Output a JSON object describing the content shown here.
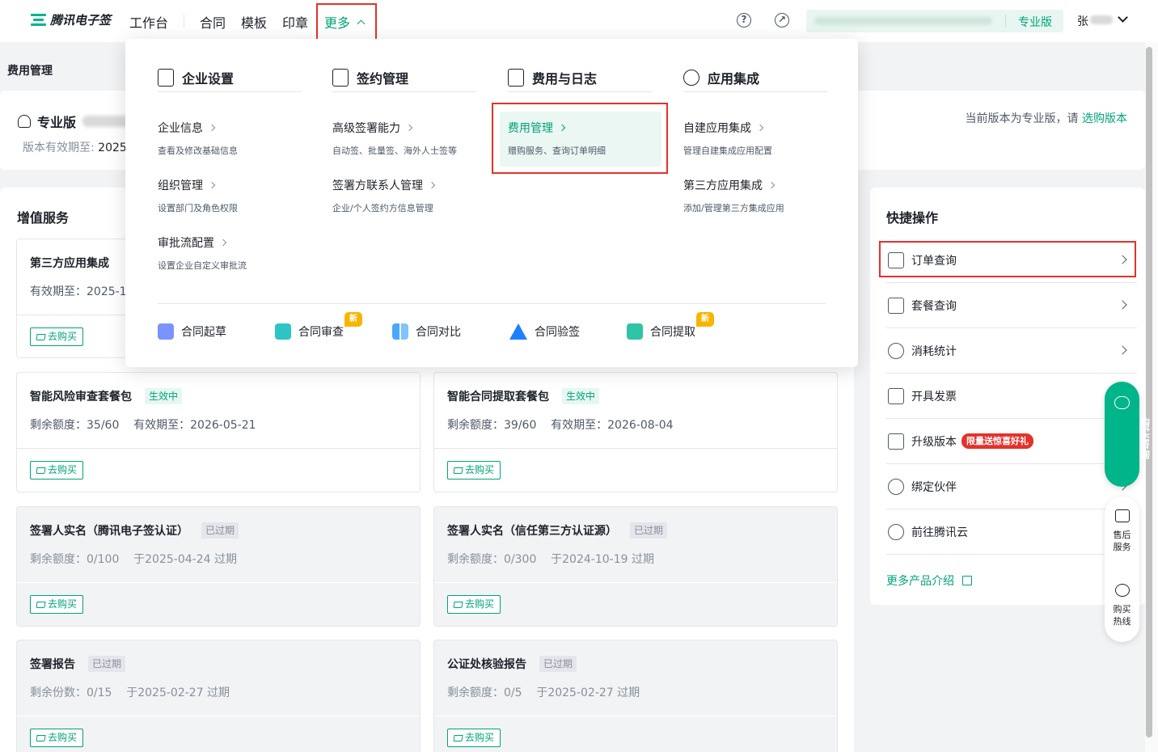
{
  "header": {
    "brand": "腾讯电子签",
    "nav": [
      "工作台",
      "合同",
      "模板",
      "印章"
    ],
    "more_label": "更多",
    "help_icon": "question-icon",
    "settings_icon": "compass-icon",
    "edition": "专业版",
    "user": "张"
  },
  "breadcrumb": "费用管理",
  "edition_card": {
    "title": "专业版",
    "valid_label": "版本有效期至:",
    "valid_value": "2025-",
    "notice": "当前版本为专业版，请",
    "notice_link": "选购版本"
  },
  "vas": {
    "title": "增值服务",
    "buy_label": "去购买",
    "cards": [
      {
        "name": "第三方应用集成",
        "info": "有效期至：2025-1"
      },
      {
        "name": "智能风险审查套餐包",
        "badge": "生效中",
        "info": "剩余额度：35/60    有效期至：2026-05-21"
      },
      {
        "name": "智能合同提取套餐包",
        "badge": "生效中",
        "info": "剩余额度：39/60    有效期至：2026-08-04"
      },
      {
        "name": "签署人实名（腾讯电子签认证）",
        "badge": "已过期",
        "info": "剩余额度：0/100    于2025-04-24 过期"
      },
      {
        "name": "签署人实名（信任第三方认证源）",
        "badge": "已过期",
        "info": "剩余额度：0/300    于2024-10-19 过期"
      },
      {
        "name": "签署报告",
        "badge": "已过期",
        "info": "剩余份数：0/15    于2025-02-27 过期"
      },
      {
        "name": "公证处核验报告",
        "badge": "已过期",
        "info": "剩余额度：0/5    于2025-02-27 过期"
      }
    ]
  },
  "quick": {
    "title": "快捷操作",
    "items": [
      {
        "label": "订单查询",
        "icon": "clipboard-icon"
      },
      {
        "label": "套餐查询",
        "icon": "package-icon"
      },
      {
        "label": "消耗统计",
        "icon": "percent-badge-icon"
      },
      {
        "label": "开具发票",
        "icon": "invoice-icon"
      },
      {
        "label": "升级版本",
        "icon": "upload-icon",
        "badge": "限量送惊喜好礼"
      },
      {
        "label": "绑定伙伴",
        "icon": "partner-icon"
      },
      {
        "label": "前往腾讯云",
        "icon": "cloud-icon"
      }
    ],
    "more_link": "更多产品介绍"
  },
  "float": {
    "consult": "购买咨询",
    "after_sales": "售后服务",
    "hotline": "购买热线"
  },
  "mega_menu": {
    "columns": [
      {
        "title": "企业设置",
        "icon": "enterprise-doc-icon",
        "items": [
          {
            "title": "企业信息",
            "desc": "查看及修改基础信息"
          },
          {
            "title": "组织管理",
            "desc": "设置部门及角色权限"
          },
          {
            "title": "审批流配置",
            "desc": "设置企业自定义审批流"
          }
        ]
      },
      {
        "title": "签约管理",
        "icon": "sign-doc-icon",
        "items": [
          {
            "title": "高级签署能力",
            "desc": "自动签、批量签、海外人士签等"
          },
          {
            "title": "签署方联系人管理",
            "desc": "企业/个人签约方信息管理"
          }
        ]
      },
      {
        "title": "费用与日志",
        "icon": "billing-icon",
        "items": [
          {
            "title": "费用管理",
            "desc": "赠购服务、查询订单明细"
          }
        ]
      },
      {
        "title": "应用集成",
        "icon": "code-gear-icon",
        "items": [
          {
            "title": "自建应用集成",
            "desc": "管理自建集成应用配置"
          },
          {
            "title": "第三方应用集成",
            "desc": "添加/管理第三方集成应用"
          }
        ]
      }
    ],
    "tools": [
      {
        "label": "合同起草",
        "icon": "pen-icon",
        "color": "#6b8cff"
      },
      {
        "label": "合同审查",
        "icon": "search-doc-icon",
        "color": "#2fc4c4",
        "new": "新"
      },
      {
        "label": "合同对比",
        "icon": "compare-icon",
        "color": "#4aa8ff"
      },
      {
        "label": "合同验签",
        "icon": "warning-icon",
        "color": "#1e80ff"
      },
      {
        "label": "合同提取",
        "icon": "extract-icon",
        "color": "#2fc4a8",
        "new": "新"
      }
    ]
  }
}
